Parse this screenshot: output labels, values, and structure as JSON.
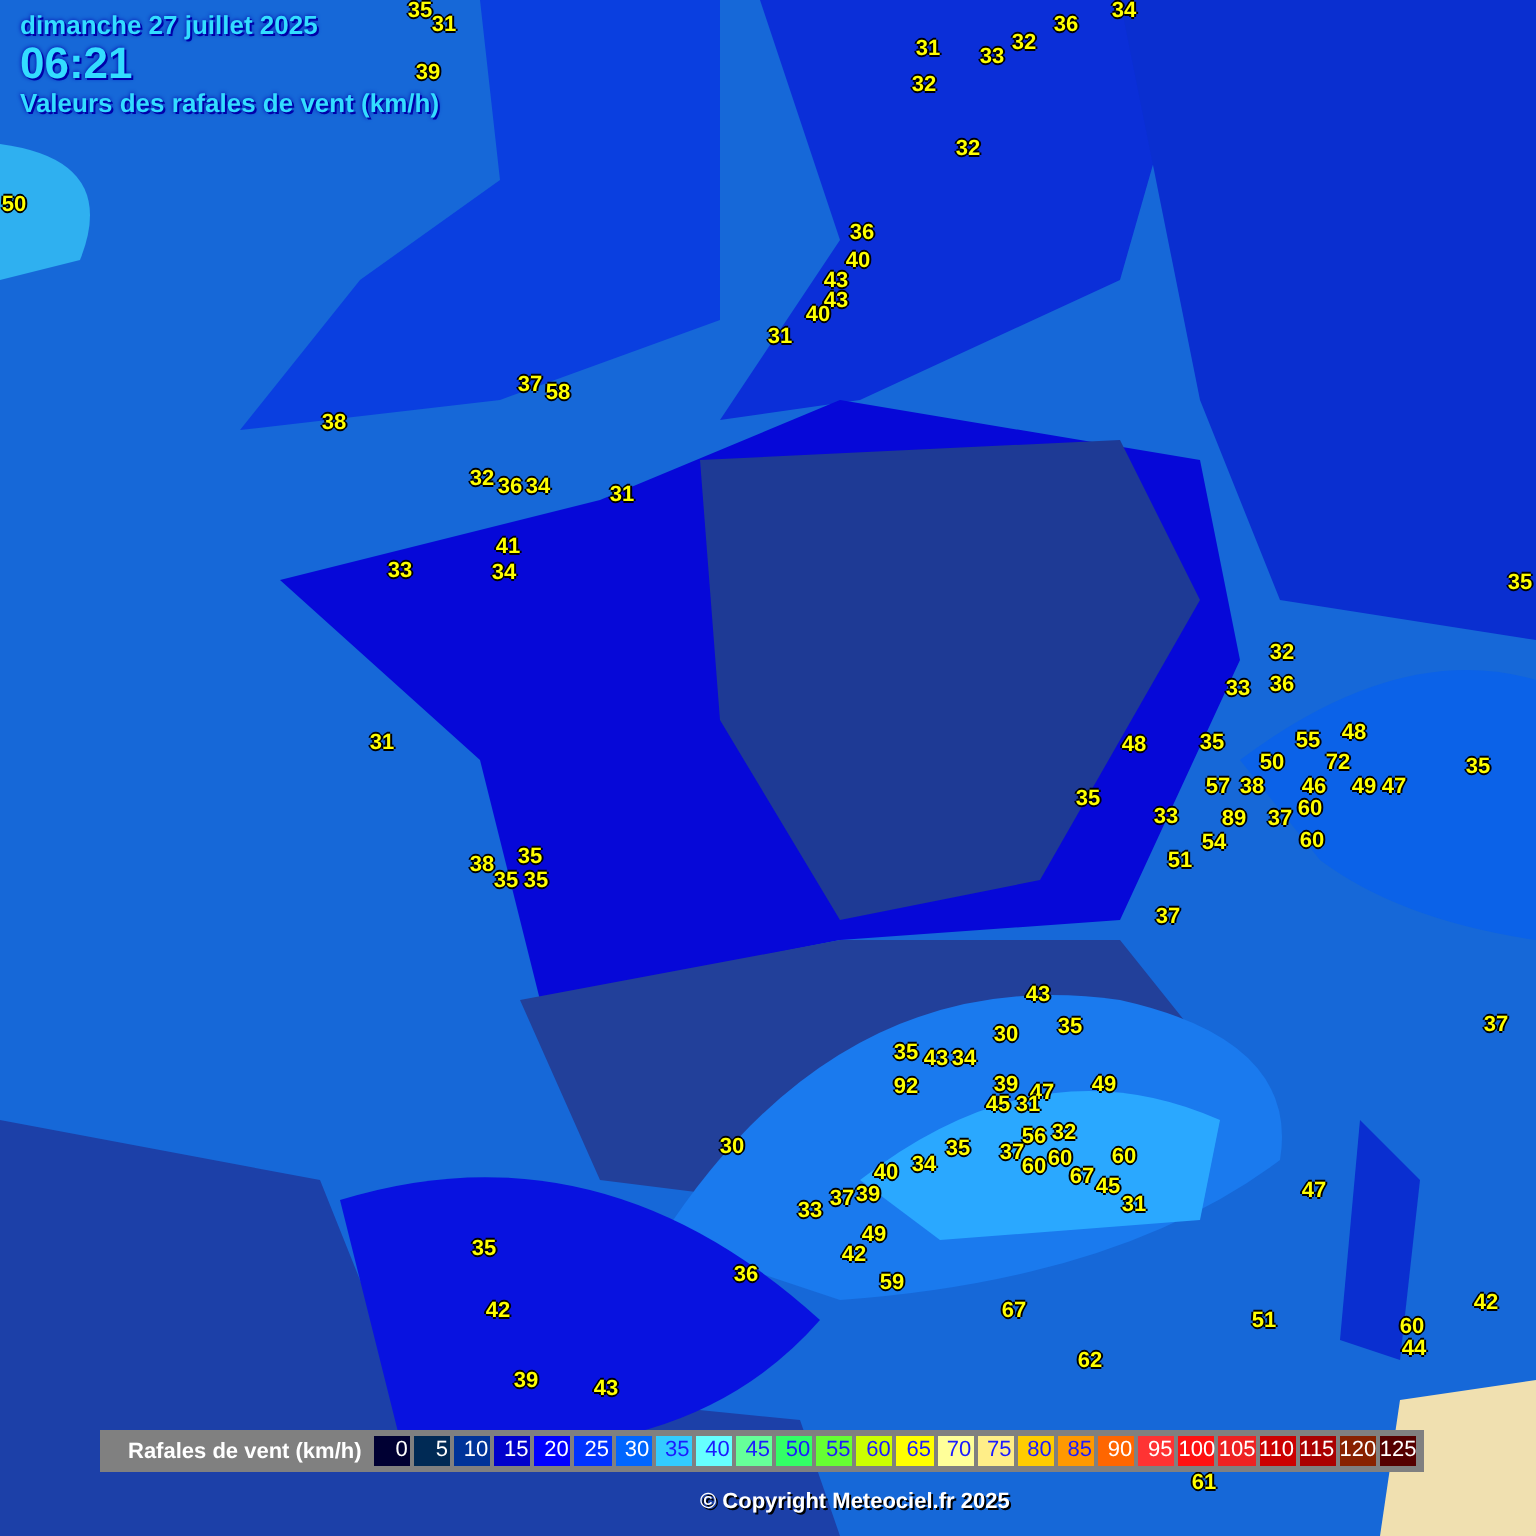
{
  "header": {
    "date": "dimanche 27 juillet 2025",
    "time": "06:21",
    "subtitle": "Valeurs des rafales de vent (km/h)"
  },
  "stations": [
    {
      "value": "35"
    },
    {
      "value": "31"
    },
    {
      "value": "39"
    },
    {
      "value": "50"
    },
    {
      "value": "31"
    },
    {
      "value": "33"
    },
    {
      "value": "32"
    },
    {
      "value": "36"
    },
    {
      "value": "34"
    },
    {
      "value": "32"
    },
    {
      "value": "32"
    },
    {
      "value": "36"
    },
    {
      "value": "40"
    },
    {
      "value": "43"
    },
    {
      "value": "43"
    },
    {
      "value": "40"
    },
    {
      "value": "31"
    },
    {
      "value": "37"
    },
    {
      "value": "58"
    },
    {
      "value": "38"
    },
    {
      "value": "32"
    },
    {
      "value": "36"
    },
    {
      "value": "34"
    },
    {
      "value": "31"
    },
    {
      "value": "41"
    },
    {
      "value": "33"
    },
    {
      "value": "34"
    },
    {
      "value": "31"
    },
    {
      "value": "38"
    },
    {
      "value": "35"
    },
    {
      "value": "35"
    },
    {
      "value": "35"
    },
    {
      "value": "43"
    },
    {
      "value": "30"
    },
    {
      "value": "35"
    },
    {
      "value": "35"
    },
    {
      "value": "43"
    },
    {
      "value": "34"
    },
    {
      "value": "92"
    },
    {
      "value": "39"
    },
    {
      "value": "47"
    },
    {
      "value": "45"
    },
    {
      "value": "31"
    },
    {
      "value": "49"
    },
    {
      "value": "56"
    },
    {
      "value": "32"
    },
    {
      "value": "37"
    },
    {
      "value": "60"
    },
    {
      "value": "60"
    },
    {
      "value": "67"
    },
    {
      "value": "60"
    },
    {
      "value": "45"
    },
    {
      "value": "31"
    },
    {
      "value": "35"
    },
    {
      "value": "34"
    },
    {
      "value": "40"
    },
    {
      "value": "33"
    },
    {
      "value": "37"
    },
    {
      "value": "39"
    },
    {
      "value": "49"
    },
    {
      "value": "42"
    },
    {
      "value": "59"
    },
    {
      "value": "30"
    },
    {
      "value": "36"
    },
    {
      "value": "35"
    },
    {
      "value": "42"
    },
    {
      "value": "39"
    },
    {
      "value": "43"
    },
    {
      "value": "67"
    },
    {
      "value": "62"
    },
    {
      "value": "51"
    },
    {
      "value": "47"
    },
    {
      "value": "60"
    },
    {
      "value": "44"
    },
    {
      "value": "42"
    },
    {
      "value": "61"
    },
    {
      "value": "37"
    },
    {
      "value": "32"
    },
    {
      "value": "33"
    },
    {
      "value": "36"
    },
    {
      "value": "48"
    },
    {
      "value": "35"
    },
    {
      "value": "55"
    },
    {
      "value": "48"
    },
    {
      "value": "50"
    },
    {
      "value": "72"
    },
    {
      "value": "35"
    },
    {
      "value": "57"
    },
    {
      "value": "38"
    },
    {
      "value": "46"
    },
    {
      "value": "49"
    },
    {
      "value": "47"
    },
    {
      "value": "33"
    },
    {
      "value": "89"
    },
    {
      "value": "37"
    },
    {
      "value": "60"
    },
    {
      "value": "54"
    },
    {
      "value": "60"
    },
    {
      "value": "51"
    },
    {
      "value": "37"
    },
    {
      "value": "35"
    },
    {
      "value": "35"
    }
  ],
  "legend": {
    "title": "Rafales de vent (km/h)",
    "steps": [
      {
        "label": "0",
        "color": "#000033"
      },
      {
        "label": "5",
        "color": "#002a55"
      },
      {
        "label": "10",
        "color": "#003399"
      },
      {
        "label": "15",
        "color": "#0000cc"
      },
      {
        "label": "20",
        "color": "#0000ff"
      },
      {
        "label": "25",
        "color": "#0033ff"
      },
      {
        "label": "30",
        "color": "#0066ff"
      },
      {
        "label": "35",
        "color": "#33ccff"
      },
      {
        "label": "40",
        "color": "#66ffff"
      },
      {
        "label": "45",
        "color": "#66ff99"
      },
      {
        "label": "50",
        "color": "#33ff66"
      },
      {
        "label": "55",
        "color": "#66ff33"
      },
      {
        "label": "60",
        "color": "#ccff00"
      },
      {
        "label": "65",
        "color": "#ffff00"
      },
      {
        "label": "70",
        "color": "#ffff99"
      },
      {
        "label": "75",
        "color": "#ffee88"
      },
      {
        "label": "80",
        "color": "#ffcc00"
      },
      {
        "label": "85",
        "color": "#ff9900"
      },
      {
        "label": "90",
        "color": "#ff6600"
      },
      {
        "label": "95",
        "color": "#ff3333"
      },
      {
        "label": "100",
        "color": "#ff1111"
      },
      {
        "label": "105",
        "color": "#ee2222"
      },
      {
        "label": "110",
        "color": "#cc0000"
      },
      {
        "label": "115",
        "color": "#aa0000"
      },
      {
        "label": "120",
        "color": "#882200"
      },
      {
        "label": "125",
        "color": "#550000"
      }
    ]
  },
  "copyright": "© Copyright Meteociel.fr 2025"
}
